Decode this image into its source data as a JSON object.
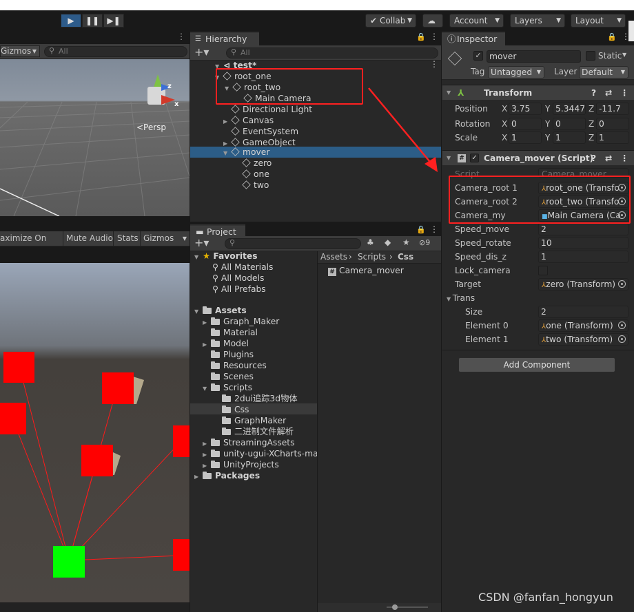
{
  "toolbar": {
    "collab": "Collab",
    "account": "Account",
    "layers": "Layers",
    "layout": "Layout"
  },
  "scene": {
    "gizmos": "Gizmos",
    "search_placeholder": "All",
    "persp": "<Persp",
    "axis_x": "x",
    "axis_z": "z"
  },
  "game": {
    "maximize": "aximize On Play",
    "mute": "Mute Audio",
    "stats": "Stats",
    "gizmos": "Gizmos"
  },
  "hierarchy": {
    "tab": "Hierarchy",
    "search_placeholder": "All",
    "scene_name": "test*",
    "items": [
      {
        "label": "root_one"
      },
      {
        "label": "root_two"
      },
      {
        "label": "Main Camera"
      },
      {
        "label": "Directional Light"
      },
      {
        "label": "Canvas"
      },
      {
        "label": "EventSystem"
      },
      {
        "label": "GameObject"
      },
      {
        "label": "mover"
      },
      {
        "label": "zero"
      },
      {
        "label": "one"
      },
      {
        "label": "two"
      }
    ]
  },
  "project": {
    "tab": "Project",
    "hidden_count": "9",
    "favorites": {
      "label": "Favorites",
      "items": [
        "All Materials",
        "All Models",
        "All Prefabs"
      ]
    },
    "assets": {
      "label": "Assets",
      "items": [
        "Graph_Maker",
        "Material",
        "Model",
        "Plugins",
        "Resources",
        "Scenes",
        "Scripts"
      ],
      "scripts_children": [
        "2dui追踪3d物体",
        "Css",
        "GraphMaker",
        "二进制文件解析"
      ],
      "after": [
        "StreamingAssets",
        "unity-ugui-XCharts-mas",
        "UnityProjects"
      ]
    },
    "packages": "Packages",
    "breadcrumb": [
      "Assets",
      "Scripts",
      "Css"
    ],
    "files": [
      "Camera_mover"
    ]
  },
  "inspector": {
    "tab": "Inspector",
    "object_name": "mover",
    "static": "Static",
    "tag_label": "Tag",
    "tag_value": "Untagged",
    "layer_label": "Layer",
    "layer_value": "Default",
    "transform": {
      "title": "Transform",
      "position": {
        "label": "Position",
        "x": "3.75",
        "y": "5.3447",
        "z": "-11.7"
      },
      "rotation": {
        "label": "Rotation",
        "x": "0",
        "y": "0",
        "z": "0"
      },
      "scale": {
        "label": "Scale",
        "x": "1",
        "y": "1",
        "z": "1"
      },
      "x": "X",
      "y": "Y",
      "z": "Z"
    },
    "script": {
      "title": "Camera_mover (Script)",
      "script_label": "Script",
      "script_value": "Camera_mover",
      "fields": {
        "camera_root_1": {
          "label": "Camera_root 1",
          "value": "root_one (Transfo"
        },
        "camera_root_2": {
          "label": "Camera_root 2",
          "value": "root_two (Transfo"
        },
        "camera_my": {
          "label": "Camera_my",
          "value": "Main Camera (Ca"
        },
        "speed_move": {
          "label": "Speed_move",
          "value": "2"
        },
        "speed_rotate": {
          "label": "Speed_rotate",
          "value": "10"
        },
        "speed_dis_z": {
          "label": "Speed_dis_z",
          "value": "1"
        },
        "lock_camera": {
          "label": "Lock_camera"
        },
        "target": {
          "label": "Target",
          "value": "zero (Transform)"
        },
        "trans": {
          "label": "Trans"
        },
        "size": {
          "label": "Size",
          "value": "2"
        },
        "element0": {
          "label": "Element 0",
          "value": "one (Transform)"
        },
        "element1": {
          "label": "Element 1",
          "value": "two (Transform)"
        }
      }
    },
    "add_component": "Add Component"
  },
  "watermark": "CSDN @fanfan_hongyun"
}
